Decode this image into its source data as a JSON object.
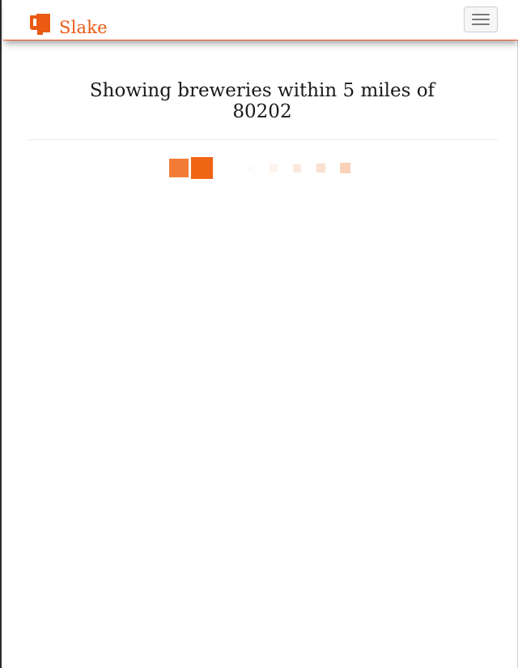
{
  "brand": {
    "name": "Slake",
    "icon": "beer-mug-icon",
    "color": "#ea5a12"
  },
  "navbar": {
    "toggle_icon": "hamburger-menu-icon",
    "accent_border": "#e8561a"
  },
  "main": {
    "heading": "Showing breweries within 5 miles of 80202"
  },
  "loader": {
    "icon": "loading-spinner-squares",
    "color": "#f06513",
    "square_opacities": [
      0.85,
      1.0,
      0.04,
      0.08,
      0.15,
      0.2,
      0.3
    ]
  }
}
